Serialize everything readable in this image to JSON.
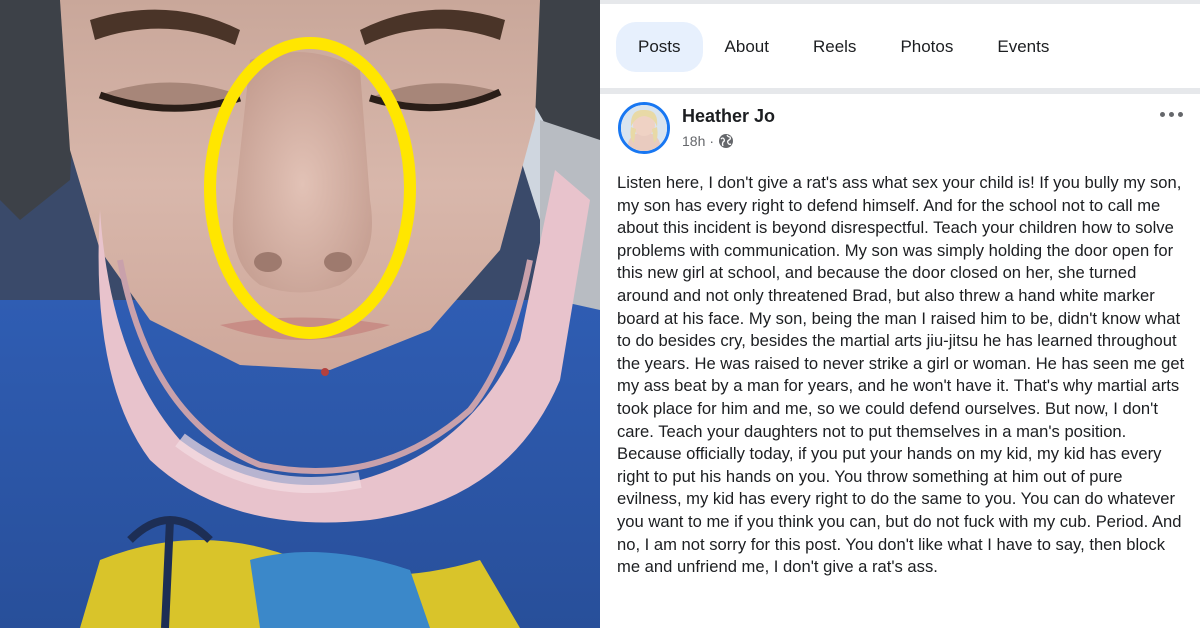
{
  "tabs": [
    {
      "label": "Posts",
      "active": true
    },
    {
      "label": "About",
      "active": false
    },
    {
      "label": "Reels",
      "active": false
    },
    {
      "label": "Photos",
      "active": false
    },
    {
      "label": "Events",
      "active": false
    }
  ],
  "post": {
    "author": "Heather Jo",
    "time": "18h",
    "separator": "·",
    "audience_icon": "globe-icon",
    "menu_icon": "more-options-icon",
    "body": "Listen here, I don't give a rat's ass what sex your child is! If you bully my son, my son has every right to defend himself. And for the school not to call me about this incident is beyond disrespectful. Teach your children how to solve problems with communication. My son was simply holding the door open for this new girl at school, and because the door closed on her, she turned around and not only threatened Brad, but also threw a hand white marker board at his face. My son, being the man I raised him to be, didn't know what to do besides cry, besides the martial arts jiu-jitsu he has learned throughout the years. He was raised to never strike a girl or woman. He has seen me get my ass beat by a man for years, and he won't have it. That's why martial arts took place for him and me, so we could defend ourselves. But now, I don't care. Teach your daughters not to put themselves in a man's position. Because officially today, if you put your hands on my kid, my kid has every right to put his hands on you. You throw something at him out of pure evilness, my kid has every right to do the same to you. You can do whatever you want to me if you think you can, but do not fuck with my cub. Period. And no, I am not sorry for this post. You don't like what I have to say, then block me and unfriend me, I don't give a rat's ass."
  },
  "colors": {
    "accent": "#1877f2",
    "active_tab_bg": "#e7f0fd",
    "highlight_ellipse": "#ffe600",
    "text": "#1c1e21",
    "muted": "#65676b"
  }
}
